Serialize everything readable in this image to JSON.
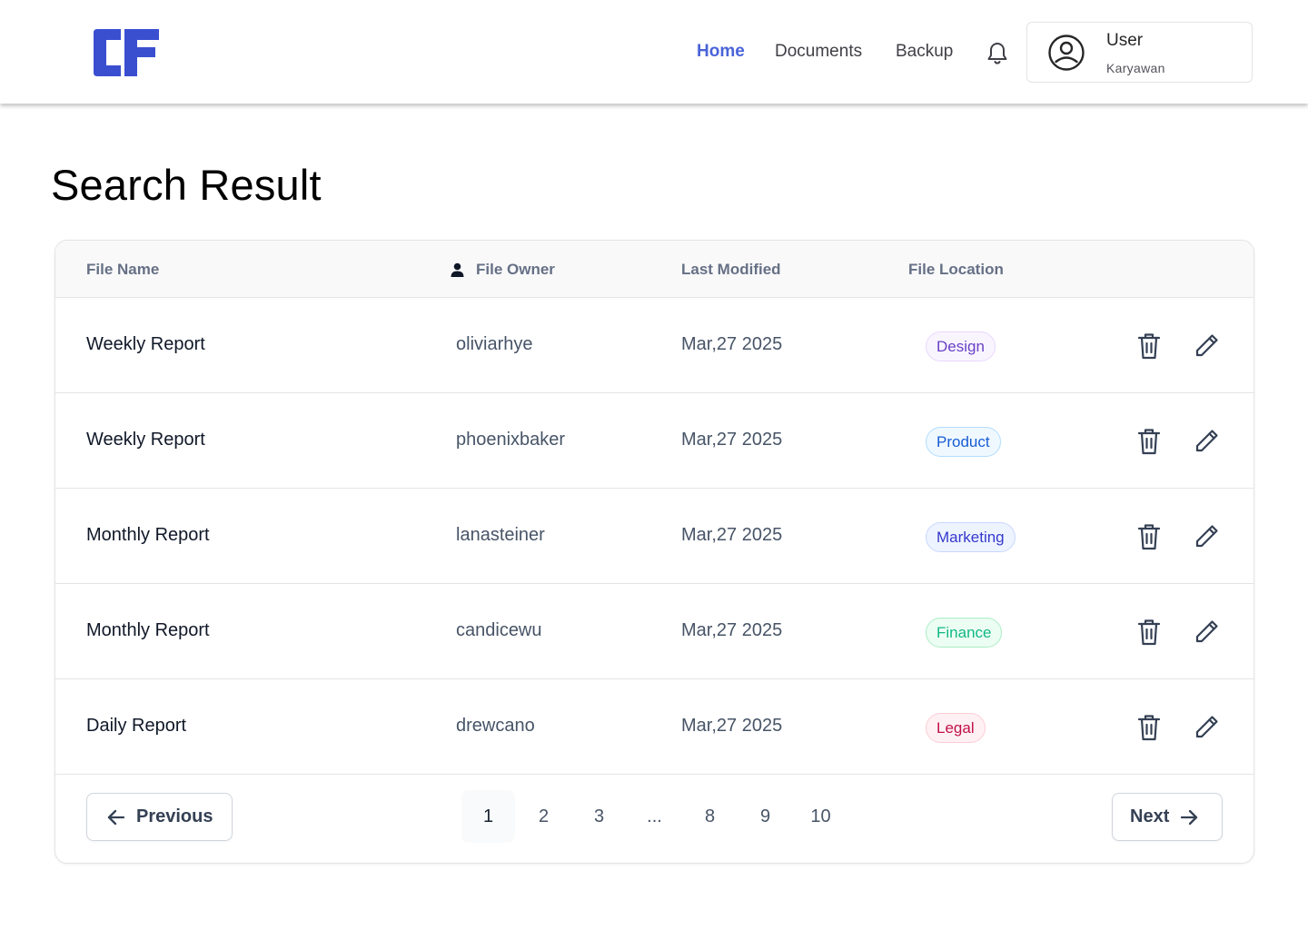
{
  "header": {
    "logo_text": "CF",
    "nav": [
      {
        "label": "Home",
        "active": true
      },
      {
        "label": "Documents",
        "active": false
      },
      {
        "label": "Backup",
        "active": false
      }
    ],
    "notification_icon": "bell-icon",
    "user": {
      "name": "User",
      "role": "Karyawan",
      "avatar_icon": "user-circle-icon"
    }
  },
  "page_title": "Search Result",
  "table": {
    "columns": {
      "name": "File Name",
      "owner": "File Owner",
      "modified": "Last Modified",
      "location": "File Location"
    },
    "rows": [
      {
        "name": "Weekly Report",
        "owner": "oliviarhye",
        "modified": "Mar,27 2025",
        "location": "Design"
      },
      {
        "name": "Weekly Report",
        "owner": "phoenixbaker",
        "modified": "Mar,27 2025",
        "location": "Product"
      },
      {
        "name": "Monthly Report",
        "owner": "lanasteiner",
        "modified": "Mar,27 2025",
        "location": "Marketing"
      },
      {
        "name": "Monthly Report",
        "owner": "candicewu",
        "modified": "Mar,27 2025",
        "location": "Finance"
      },
      {
        "name": "Daily Report",
        "owner": "drewcano",
        "modified": "Mar,27 2025",
        "location": "Legal"
      }
    ],
    "row_actions": [
      "trash-icon",
      "pencil-icon"
    ]
  },
  "pagination": {
    "previous_label": "Previous",
    "next_label": "Next",
    "pages": [
      "1",
      "2",
      "3",
      "...",
      "8",
      "9",
      "10"
    ],
    "current_page": "1"
  },
  "colors": {
    "brand": "#3a4fd0",
    "nav_active": "#4a63d8",
    "badge_design": {
      "text": "#6941c6",
      "bg": "#f9f5ff",
      "border": "#e9d7fe"
    },
    "badge_product": {
      "text": "#175cd3",
      "bg": "#eff8ff",
      "border": "#b2ddff"
    },
    "badge_marketing": {
      "text": "#3538cd",
      "bg": "#eef4ff",
      "border": "#c7d7fe"
    },
    "badge_finance": {
      "text": "#12b886",
      "bg": "#ecfdf3",
      "border": "#abefc6"
    },
    "badge_legal": {
      "text": "#c01048",
      "bg": "#fff1f3",
      "border": "#fecdd6"
    }
  }
}
